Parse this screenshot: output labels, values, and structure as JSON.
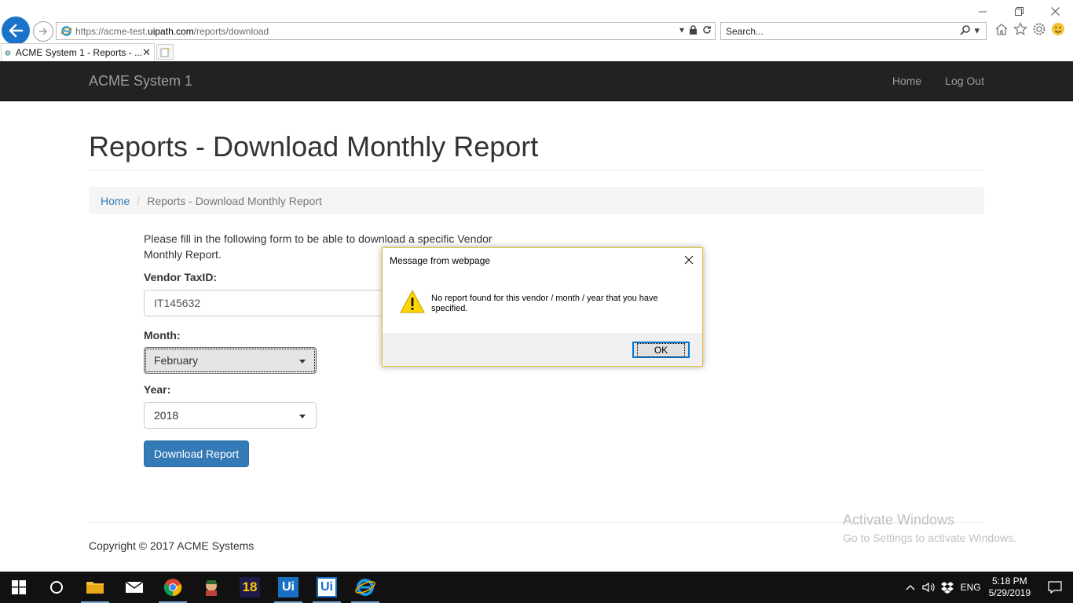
{
  "browser": {
    "url_prefix": "https://acme-test.",
    "url_domain": "uipath.com",
    "url_path": "/reports/download",
    "search_placeholder": "Search...",
    "tab_title": "ACME System 1 - Reports - ...",
    "tab_close": "✕"
  },
  "navbar": {
    "brand": "ACME System 1",
    "links": [
      "Home",
      "Log Out"
    ]
  },
  "page": {
    "title": "Reports - Download Monthly Report",
    "breadcrumb_home": "Home",
    "breadcrumb_sep": "/",
    "breadcrumb_current": "Reports - Download Monthly Report",
    "intro": "Please fill in the following form to be able to download a specific Vendor Monthly Report.",
    "vendor_label": "Vendor TaxID:",
    "vendor_value": "IT145632",
    "month_label": "Month:",
    "month_value": "February",
    "year_label": "Year:",
    "year_value": "2018",
    "download_button": "Download Report",
    "footer": "Copyright © 2017 ACME Systems"
  },
  "watermark": {
    "line1": "Activate Windows",
    "line2": "Go to Settings to activate Windows."
  },
  "dialog": {
    "title": "Message from webpage",
    "message": "No report found for this vendor / month / year that you have specified.",
    "ok_label": "OK"
  },
  "taskbar": {
    "lang": "ENG",
    "time": "5:18 PM",
    "date": "5/29/2019",
    "app_18_label": "18",
    "app_ui_label": "Ui",
    "app_ui2_label": "Ui"
  }
}
